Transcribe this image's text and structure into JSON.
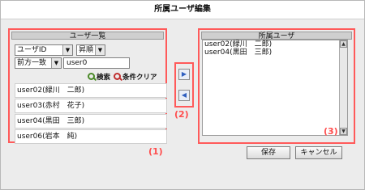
{
  "dialog": {
    "title": "所属ユーザ編集"
  },
  "user_list_panel": {
    "header": "ユーザ一覧",
    "field_select": "ユーザID",
    "order_select": "昇順",
    "match_select": "前方一致",
    "search_value": "user0",
    "search_label": "検索",
    "clear_label": "条件クリア",
    "rows": [
      "user02(緑川　二郎)",
      "user03(赤村　花子)",
      "user04(黒田　三郎)",
      "user06(岩本　純)"
    ]
  },
  "move_buttons": {
    "add_icon": "arrow-right-icon",
    "remove_icon": "arrow-left-icon"
  },
  "member_panel": {
    "header": "所属ユーザ",
    "items": [
      "user02(緑川　二郎)",
      "user04(黒田　三郎)"
    ]
  },
  "annotations": {
    "label1": "(1)",
    "label2": "(2)",
    "label3": "(3)"
  },
  "footer": {
    "save_label": "保存",
    "cancel_label": "キャンセル"
  },
  "colors": {
    "annotation": "#ff4d4d",
    "header_bg": "#cfcfcf",
    "dialog_bg": "#ececec"
  }
}
